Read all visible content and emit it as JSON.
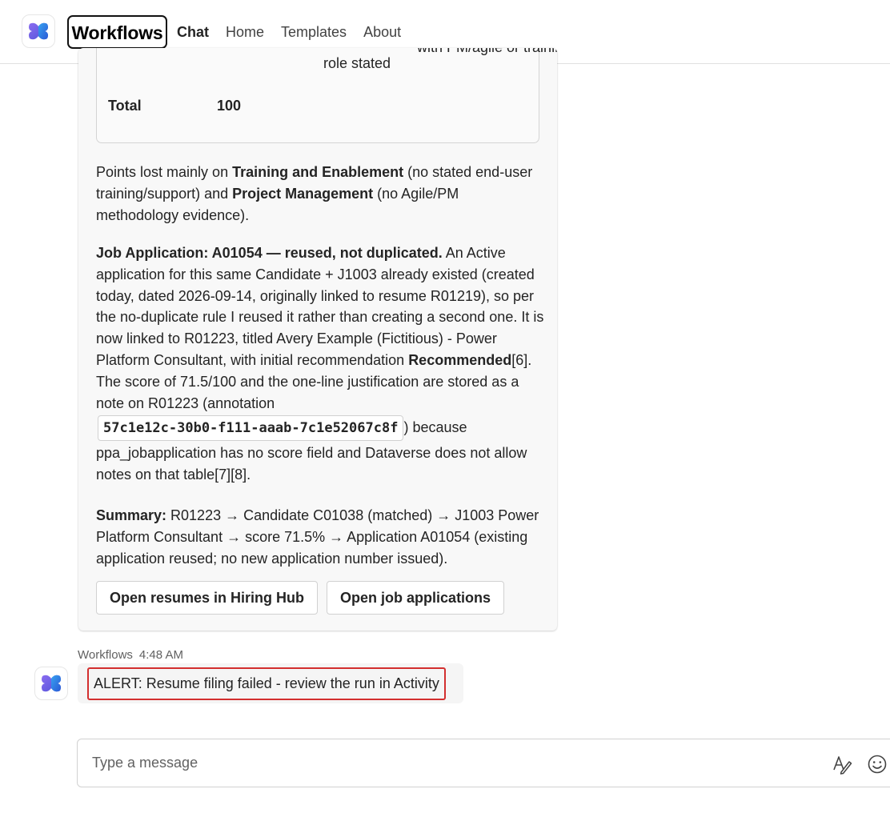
{
  "app": {
    "title": "Workflows",
    "logo_icon": "workflows-logo-icon",
    "accent_color": "#5b5fc7"
  },
  "tabs": [
    {
      "label": "Chat",
      "active": true
    },
    {
      "label": "Home",
      "active": false
    },
    {
      "label": "Templates",
      "active": false
    },
    {
      "label": "About",
      "active": false
    }
  ],
  "card": {
    "table": {
      "partial_text": "with PM/agile or training support beyond the",
      "role_text": "role stated",
      "total_label": "Total",
      "total_value": "100"
    },
    "p1": {
      "t1": "Points lost mainly on ",
      "b1": "Training and Enablement",
      "t2": " (no stated end-user training/support) and ",
      "b2": "Project Management",
      "t3": " (no Agile/PM methodology evidence)."
    },
    "p2": {
      "b1": "Job Application: A01054 — reused, not duplicated.",
      "t1": " An Active application for this same Candidate + J1003 already existed (created today, dated 2026-09-14, originally linked to resume R01219), so per the no-duplicate rule I reused it rather than creating a second one. It is now linked to R01223, titled Avery Example (Fictitious) - Power Platform Consultant, with initial recommendation ",
      "b2": "Recommended",
      "t2": "[6]. The score of 71.5/100 and the one-line justification are stored as a note on R01223 (annotation ",
      "code": "57c1e12c-30b0-f111-aaab-7c1e52067c8f",
      "t3": ") because ppa_jobapplication has no score field and Dataverse does not allow notes on that table[7][8]."
    },
    "p3": {
      "b1": "Summary:",
      "t1": " R01223 → Candidate C01038 (matched) → J1003 Power Platform Consultant → score 71.5% → Application A01054 (existing application reused; no new application number issued)."
    },
    "buttons": {
      "open_resumes": "Open resumes in Hiring Hub",
      "open_applications": "Open job applications"
    }
  },
  "message2": {
    "sender": "Workflows",
    "time": "4:48 AM",
    "text": "ALERT: Resume filing failed - review the run in Activity",
    "highlight_color": "#d32f2f"
  },
  "compose": {
    "placeholder": "Type a message",
    "format_icon": "format-text-icon",
    "emoji_icon": "emoji-icon"
  }
}
